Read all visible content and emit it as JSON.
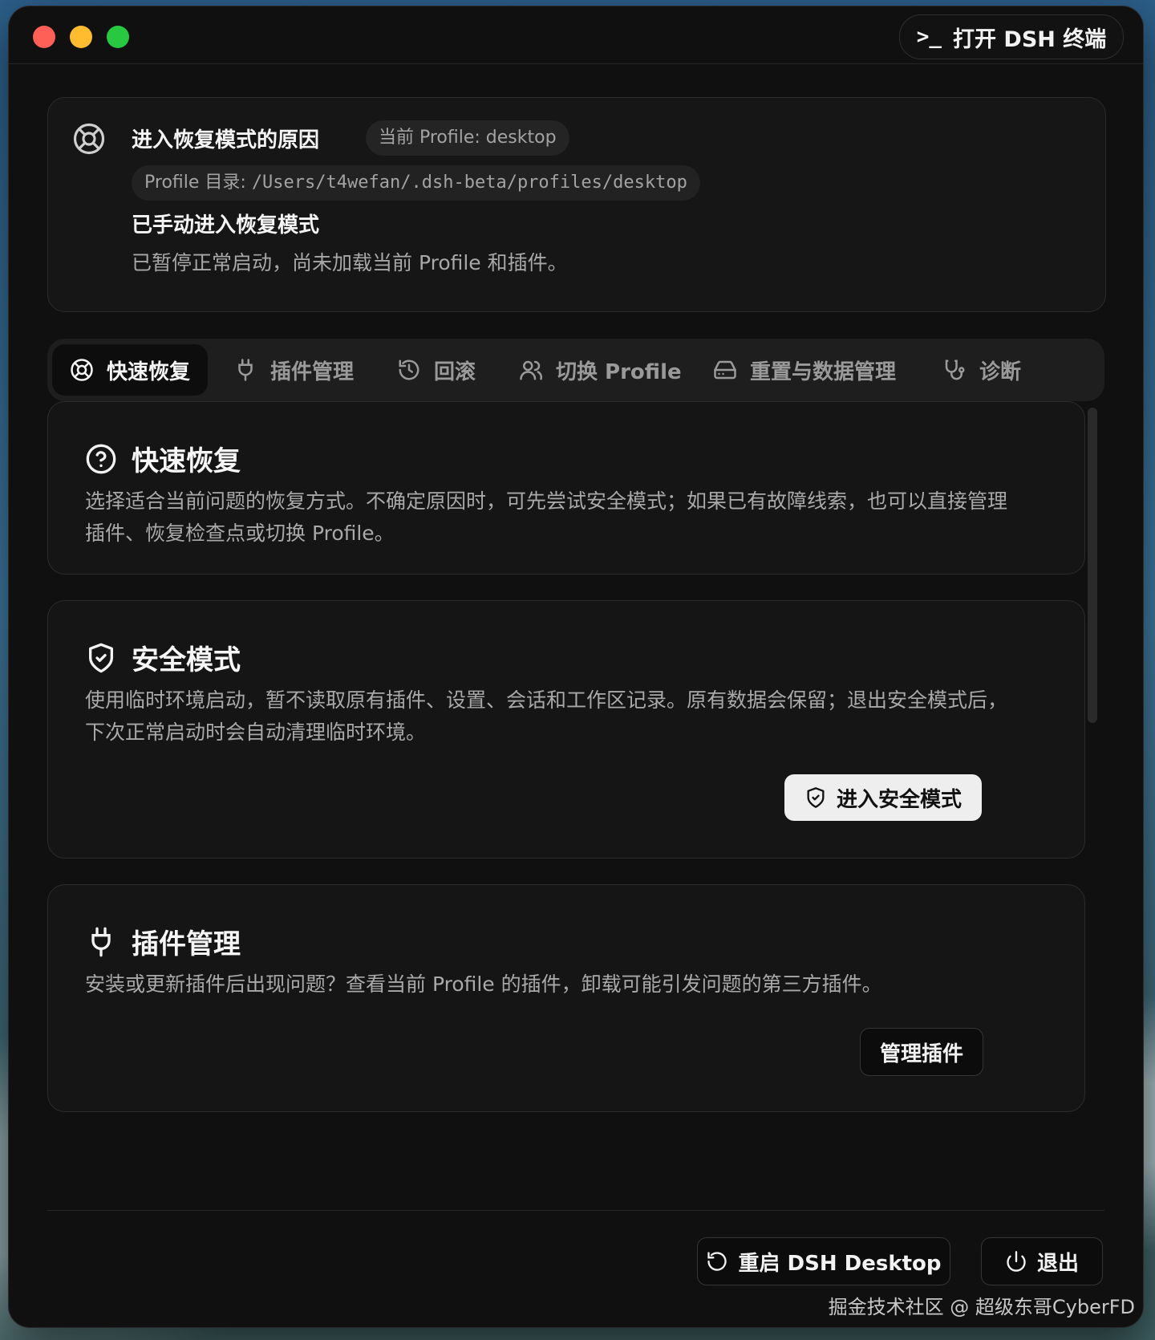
{
  "titlebar": {
    "terminal_button": {
      "prompt": ">_",
      "label": "打开 DSH 终端"
    }
  },
  "recovery_reason": {
    "title": "进入恢复模式的原因",
    "profile_badge": "当前 Profile: desktop",
    "dir_label": "Profile 目录: ",
    "dir_path": "/Users/t4wefan/.dsh-beta/profiles/desktop",
    "reason_title": "已手动进入恢复模式",
    "reason_desc": "已暂停正常启动，尚未加载当前 Profile 和插件。"
  },
  "tabs": [
    {
      "label": "快速恢复",
      "icon": "lifebuoy-icon",
      "active": true
    },
    {
      "label": "插件管理",
      "icon": "plug-icon"
    },
    {
      "label": "回滚",
      "icon": "history-icon"
    },
    {
      "label": "切换 Profile",
      "icon": "users-icon"
    },
    {
      "label": "重置与数据管理",
      "icon": "hard-drive-icon"
    },
    {
      "label": "诊断",
      "icon": "stethoscope-icon"
    }
  ],
  "cards": {
    "quick": {
      "title": "快速恢复",
      "desc": "选择适合当前问题的恢复方式。不确定原因时，可先尝试安全模式；如果已有故障线索，也可以直接管理插件、恢复检查点或切换 Profile。"
    },
    "safe": {
      "title": "安全模式",
      "desc": "使用临时环境启动，暂不读取原有插件、设置、会话和工作区记录。原有数据会保留；退出安全模式后，下次正常启动时会自动清理临时环境。",
      "button": "进入安全模式"
    },
    "plugins": {
      "title": "插件管理",
      "desc": "安装或更新插件后出现问题？查看当前 Profile 的插件，卸载可能引发问题的第三方插件。",
      "button": "管理插件"
    }
  },
  "footer": {
    "restart_button": "重启 DSH Desktop",
    "quit_button": "退出"
  },
  "watermark": "掘金技术社区 @ 超级东哥CyberFD"
}
